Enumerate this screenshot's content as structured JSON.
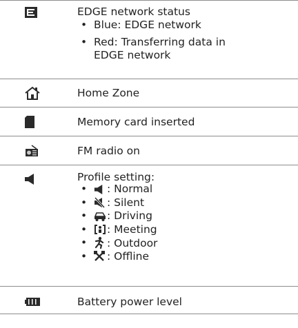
{
  "rows": [
    {
      "icon": "edge-network-icon",
      "title": "EDGE network status",
      "bullets": [
        "Blue: EDGE network",
        "Red: Transferring data in EDGE network"
      ]
    },
    {
      "icon": "home-zone-icon",
      "title": "Home Zone"
    },
    {
      "icon": "memory-card-icon",
      "title": "Memory card inserted"
    },
    {
      "icon": "fm-radio-icon",
      "title": "FM radio on"
    },
    {
      "icon": "speaker-icon",
      "title": "Profile setting:",
      "profiles": [
        {
          "icon": "speaker-icon",
          "label": ": Normal"
        },
        {
          "icon": "silent-icon",
          "label": ": Silent"
        },
        {
          "icon": "car-icon",
          "label": ": Driving"
        },
        {
          "icon": "meeting-icon",
          "label": ": Meeting"
        },
        {
          "icon": "running-person-icon",
          "label": ": Outdoor"
        },
        {
          "icon": "crossed-tools-icon",
          "label": ": Offline"
        }
      ]
    },
    {
      "icon": "battery-icon",
      "title": "Battery power level"
    }
  ],
  "colors": {
    "rule": "#8c8c8c",
    "icon": "#2a2a2a",
    "text": "#222222"
  }
}
